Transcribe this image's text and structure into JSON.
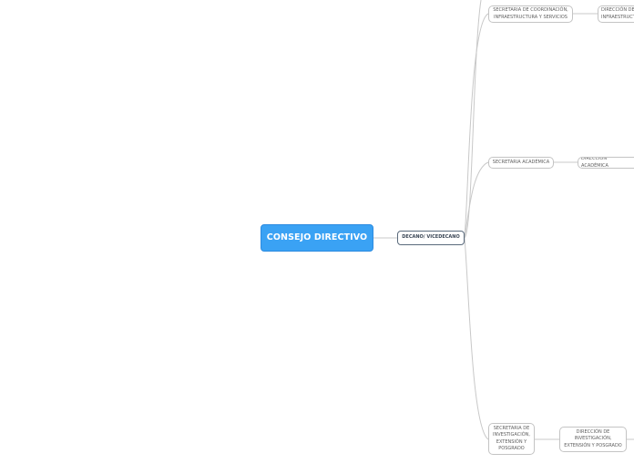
{
  "nodes": {
    "root": "CONSEJO DIRECTIVO",
    "decano": "DECANO/ VICEDECANO",
    "sec_coordinacion": "SECRETARIA DE COORDINACIÓN,\nINFRAESTRUCTURA Y SERVICIOS",
    "dir_infraestructura": "DIRECCIÓN DE\nINFRAESTRUCTURA",
    "sec_academica": "SECRETARIA ACADÉMICA",
    "dir_academica": "DIRECCIÓN ACADÉMICA",
    "sec_investigacion": "SECRETARIA DE\nINVESTIGACIÓN,\nEXTENSIÓN Y\nPOSGRADO",
    "dir_investigacion": "DIRECCIÓN DE\nINVESTIGACIÓN,\nEXTENSIÓN Y POSGRADO"
  },
  "colors": {
    "root_fill": "#3aa2f4",
    "connector": "#c8c8c8"
  }
}
